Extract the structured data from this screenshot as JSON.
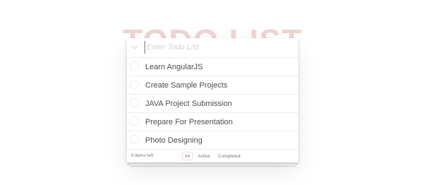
{
  "app": {
    "title": "TODO LIST"
  },
  "header": {
    "toggle_icon": "chevron-down-icon",
    "input_placeholder": "Enter Todo List",
    "input_value": ""
  },
  "todos": [
    {
      "text": "Learn AngularJS",
      "completed": false
    },
    {
      "text": "Create Sample Projects",
      "completed": false
    },
    {
      "text": "JAVA Project Submission",
      "completed": false
    },
    {
      "text": "Prepare For Presentation",
      "completed": false
    },
    {
      "text": "Photo Designing",
      "completed": false
    }
  ],
  "footer": {
    "items_left": "5 items left",
    "filters": {
      "all": "All",
      "active": "Active",
      "completed": "Completed"
    },
    "selected_filter": "All"
  },
  "colors": {
    "title": "#efd4d4",
    "text": "#4d4d4d",
    "placeholder": "#d3d3d3",
    "divider": "#ededed"
  }
}
